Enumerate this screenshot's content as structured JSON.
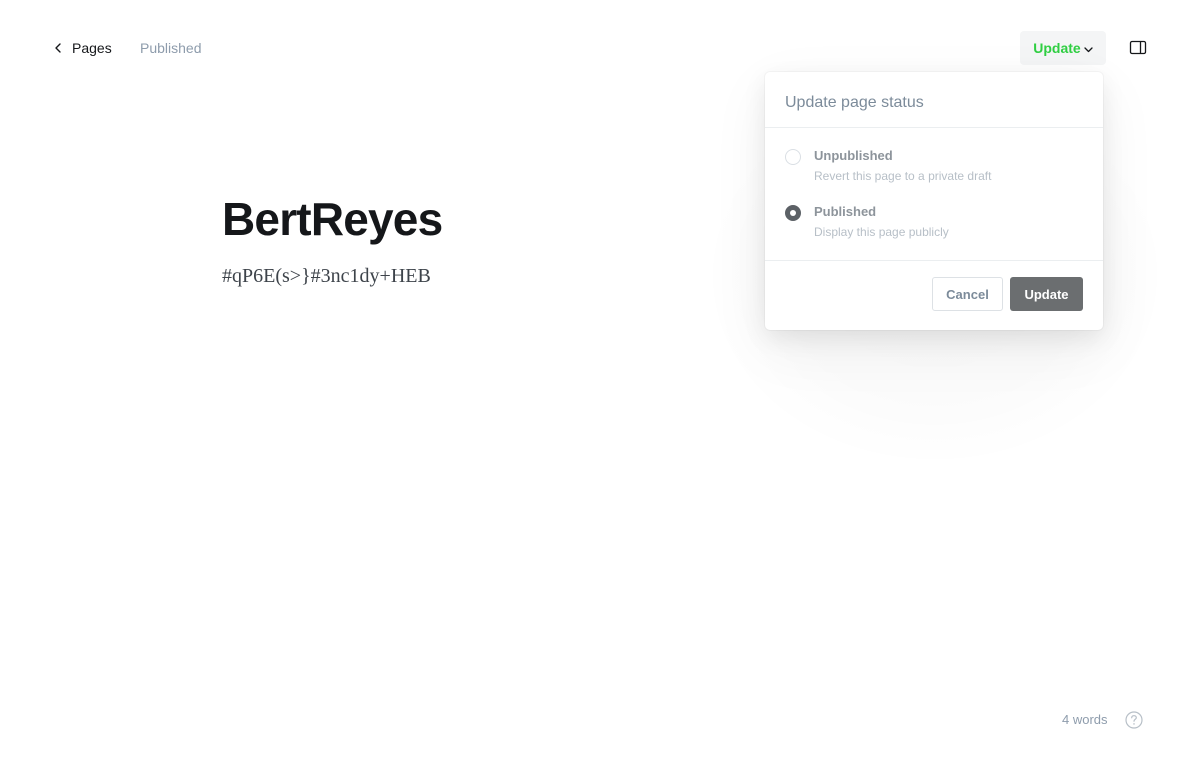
{
  "header": {
    "back_label": "Pages",
    "status": "Published",
    "update_label": "Update",
    "accent_color": "#30cf43"
  },
  "post": {
    "title": "BertReyes",
    "body": "#qP6E(s>}#3nc1dy+HEB"
  },
  "status_menu": {
    "title": "Update page status",
    "options": [
      {
        "label": "Unpublished",
        "description": "Revert this page to a private draft",
        "selected": false
      },
      {
        "label": "Published",
        "description": "Display this page publicly",
        "selected": true
      }
    ],
    "cancel_label": "Cancel",
    "confirm_label": "Update"
  },
  "footer": {
    "word_count": "4 words"
  },
  "icons": {
    "back": "chevron-left-icon",
    "dropdown": "chevron-down-icon",
    "sidebar": "sidebar-panel-icon",
    "help": "question-circle-icon"
  }
}
